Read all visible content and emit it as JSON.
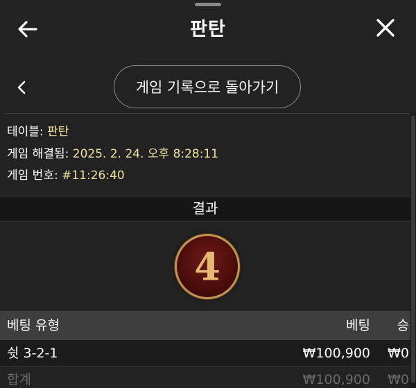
{
  "header": {
    "title": "판탄",
    "back_icon": "arrow-left-icon",
    "close_icon": "close-icon"
  },
  "nav": {
    "back_icon": "chevron-left-icon",
    "history_button_label": "게임 기록으로 돌아가기"
  },
  "info": {
    "table_label": "테이블:",
    "table_value": "판탄",
    "resolved_label": "게임 해결됨:",
    "resolved_value": "2025. 2. 24. 오후 8:28:11",
    "game_number_label": "게임 번호:",
    "game_number_value": "#11:26:40"
  },
  "result": {
    "heading": "결과",
    "value": "4"
  },
  "bets_table": {
    "columns": {
      "type": "베팅 유형",
      "bet": "베팅",
      "win": "승"
    },
    "rows": [
      {
        "type": "쉿 3-2-1",
        "bet": "₩100,900",
        "win": "₩0"
      }
    ],
    "total": {
      "type": "합계",
      "bet": "₩100,900",
      "win": "₩0"
    }
  },
  "colors": {
    "background": "#222222",
    "value_text": "#f0e0a2",
    "ball_fill": "#4a0d0b",
    "ball_ring": "#c39454",
    "table_header": "#3e3e3e"
  }
}
